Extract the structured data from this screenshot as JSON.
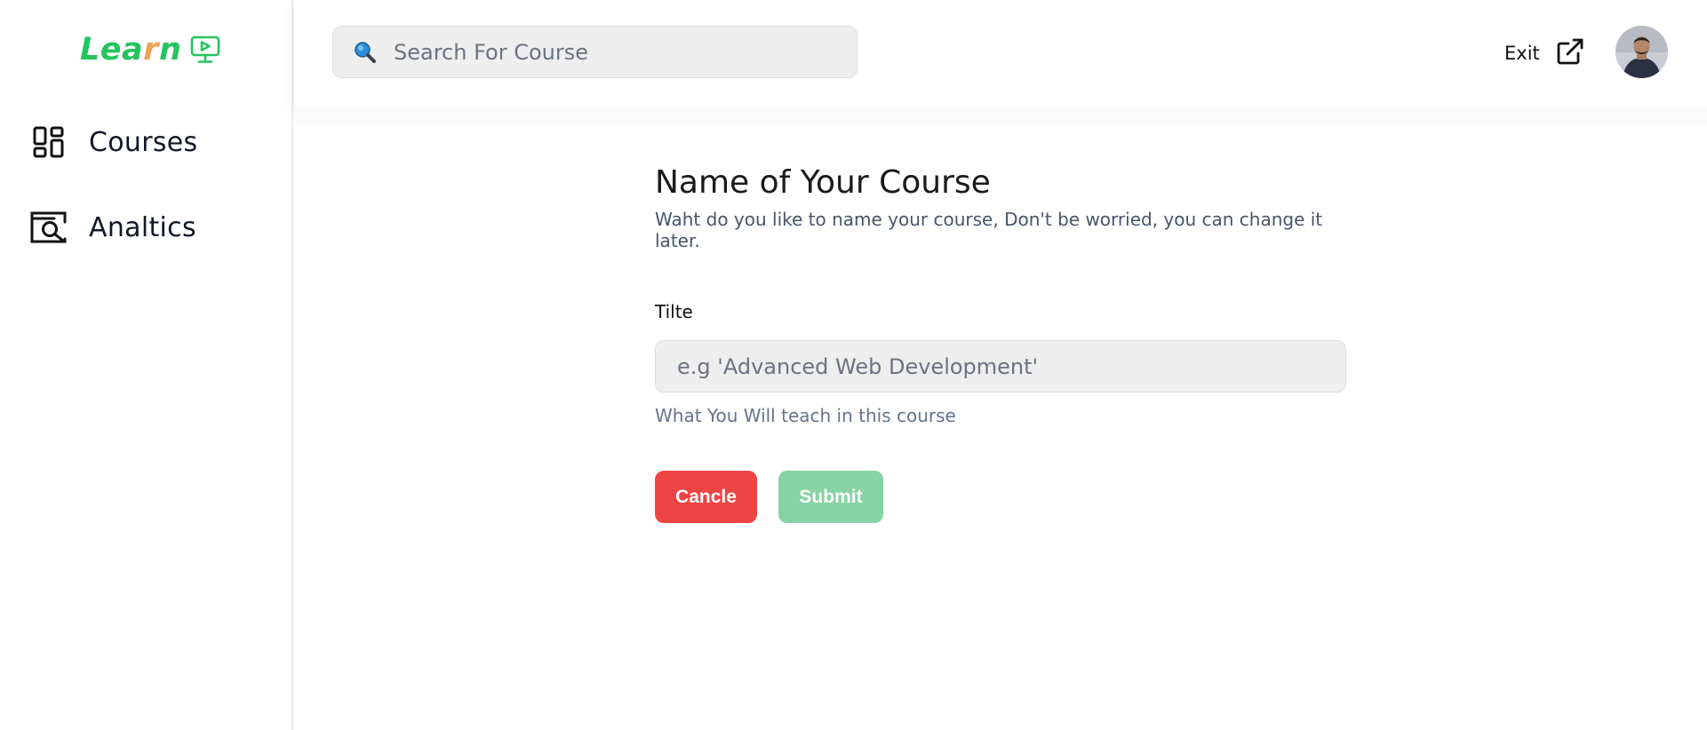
{
  "brand": {
    "logo_part1": "Lea",
    "logo_accent": "r",
    "logo_part2": "n",
    "primary_color": "#22c55e",
    "accent_color": "#f0a150",
    "logo_icon": "monitor-play-icon"
  },
  "sidebar": {
    "items": [
      {
        "label": "Courses",
        "icon": "dashboard-grid-icon"
      },
      {
        "label": "Analtics",
        "icon": "browser-search-icon"
      }
    ]
  },
  "header": {
    "search": {
      "placeholder": "Search For Course",
      "value": "",
      "icon": "magnifier-icon"
    },
    "exit_label": "Exit",
    "exit_icon": "external-link-icon",
    "avatar": "user-avatar"
  },
  "form": {
    "title": "Name of Your Course",
    "subtitle": "Waht do you like to name your course, Don't be worried, you can change it later.",
    "field_label": "Tilte",
    "input_placeholder": "e.g 'Advanced Web Development'",
    "input_value": "",
    "helper_text": "What You Will teach in this course",
    "cancel_label": "Cancle",
    "submit_label": "Submit",
    "cancel_color": "#ef4444",
    "submit_color": "#86d3a3"
  }
}
